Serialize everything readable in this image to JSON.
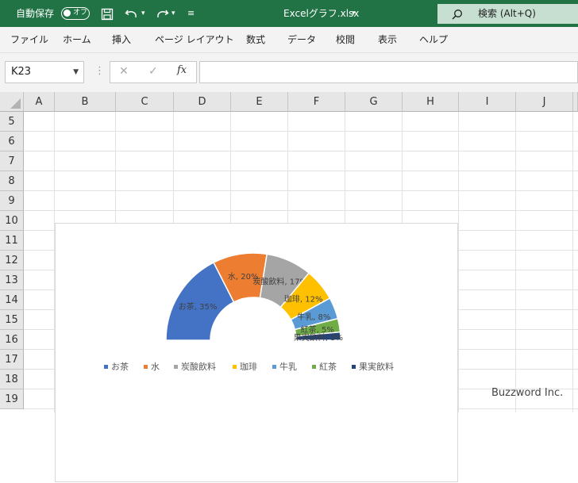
{
  "titlebar": {
    "autosave_label": "自動保存",
    "autosave_state": "オフ",
    "filename": "Excelグラフ.xlsx",
    "search_label": "検索 (Alt+Q)",
    "accent_color": "#217346"
  },
  "ribbon": {
    "tabs": [
      "ファイル",
      "ホーム",
      "挿入",
      "ページ レイアウト",
      "数式",
      "データ",
      "校閲",
      "表示",
      "ヘルプ"
    ]
  },
  "formula_bar": {
    "name_box": "K23",
    "cancel_icon": "✕",
    "enter_icon": "✓",
    "fx_label": "fx",
    "formula": ""
  },
  "sheet": {
    "columns": [
      "A",
      "B",
      "C",
      "D",
      "E",
      "F",
      "G",
      "H",
      "I",
      "J"
    ],
    "rows": [
      "5",
      "6",
      "7",
      "8",
      "9",
      "10",
      "11",
      "12",
      "13",
      "14",
      "15",
      "16",
      "17",
      "18",
      "19"
    ]
  },
  "chart_data": {
    "type": "pie",
    "variant": "doughnut-half",
    "categories": [
      "お茶",
      "水",
      "炭酸飲料",
      "珈琲",
      "牛乳",
      "紅茶",
      "果実飲料"
    ],
    "values": [
      35,
      20,
      17,
      12,
      8,
      5,
      3
    ],
    "data_labels": [
      "お茶, 35%",
      "水, 20%",
      "炭酸飲料, 17%",
      "珈琲, 12%",
      "牛乳, 8%",
      "紅茶, 5%",
      "果実飲料, 3%"
    ],
    "colors": [
      "#4472c4",
      "#ed7d31",
      "#a5a5a5",
      "#ffc000",
      "#5b9bd5",
      "#70ad47",
      "#264478"
    ],
    "legend": "bottom"
  },
  "watermark": "Buzzword Inc."
}
